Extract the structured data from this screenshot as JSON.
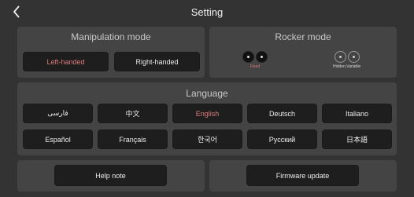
{
  "header": {
    "title": "Setting"
  },
  "manipulation": {
    "title": "Manipulation mode",
    "options": [
      "Left-handed",
      "Right-handed"
    ],
    "selected": "Left-handed"
  },
  "rocker": {
    "title": "Rocker mode",
    "options": [
      "Fixed",
      "Hidden,Variable"
    ],
    "selected": "Fixed"
  },
  "language": {
    "title": "Language",
    "options": [
      "فارسی",
      "中文",
      "English",
      "Deutsch",
      "Italiano",
      "Español",
      "Français",
      "한국어",
      "Русский",
      "日本語"
    ],
    "selected": "English"
  },
  "footer": {
    "help_label": "Help note",
    "firmware_label": "Firmware update"
  },
  "colors": {
    "accent": "#e07a7a",
    "panel": "#444444",
    "background": "#333333",
    "button": "#1e1e1e"
  },
  "icons": {
    "back": "chevron-left-icon"
  }
}
